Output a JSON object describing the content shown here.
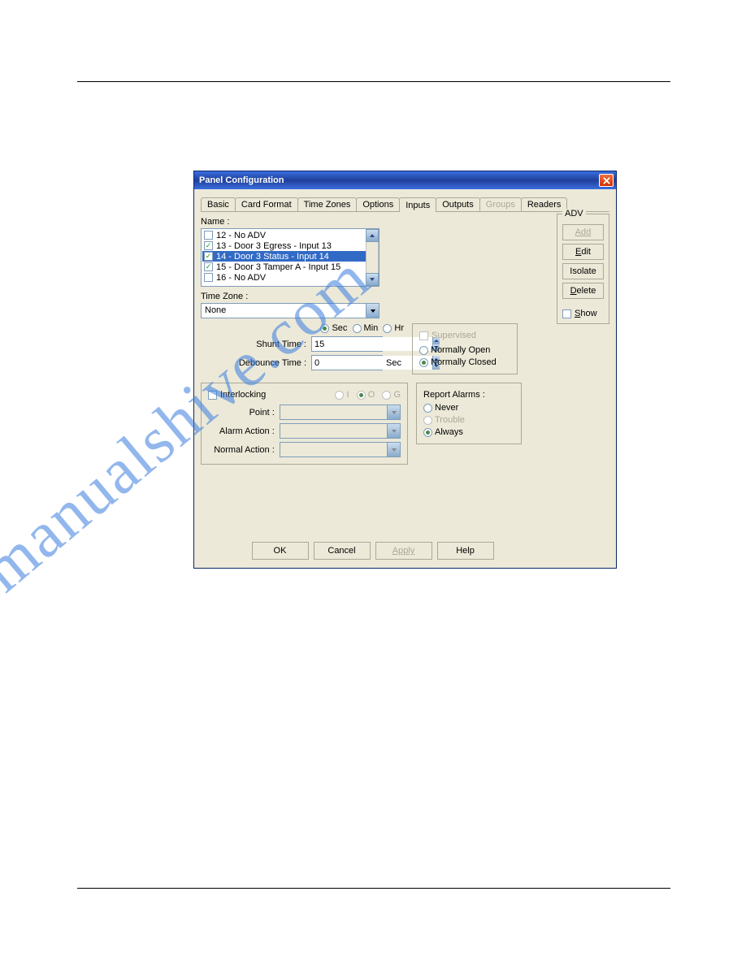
{
  "watermark": "manualshive.com",
  "dialog": {
    "title": "Panel Configuration",
    "tabs": [
      "Basic",
      "Card Format",
      "Time Zones",
      "Options",
      "Inputs",
      "Outputs",
      "Groups",
      "Readers"
    ],
    "active_tab": "Inputs",
    "name_label": "Name :",
    "name_list": [
      {
        "checked": false,
        "label": "12 - No ADV"
      },
      {
        "checked": true,
        "label": "13 - Door 3 Egress - Input 13"
      },
      {
        "checked": true,
        "label": "14 - Door 3 Status - Input 14",
        "selected": true
      },
      {
        "checked": true,
        "label": "15 - Door 3 Tamper A - Input 15"
      },
      {
        "checked": false,
        "label": "16 - No ADV"
      }
    ],
    "timezone_label": "Time Zone :",
    "timezone_value": "None",
    "time_units": {
      "sec": "Sec",
      "min": "Min",
      "hr": "Hr",
      "trailing_sec": "Sec"
    },
    "shunt_label": "Shunt Time :",
    "shunt_value": "15",
    "debounce_label": "Debounce Time :",
    "debounce_value": "0",
    "supervised": {
      "label": "Supervised",
      "opt1": "Normally Open",
      "opt2": "Normally Closed",
      "selected": "Normally Closed"
    },
    "interlock": {
      "title": "Interlocking",
      "mode_I": "I",
      "mode_O": "O",
      "mode_G": "G",
      "point": "Point :",
      "alarm": "Alarm Action :",
      "normal": "Normal Action :"
    },
    "report_alarms": {
      "title": "Report Alarms :",
      "never": "Never",
      "trouble": "Trouble",
      "always": "Always",
      "selected": "Always"
    },
    "adv": {
      "title": "ADV",
      "add": "Add",
      "edit": "Edit",
      "isolate": "Isolate",
      "delete": "Delete",
      "show": "Show"
    },
    "buttons": {
      "ok": "OK",
      "cancel": "Cancel",
      "apply": "Apply",
      "help": "Help"
    }
  }
}
